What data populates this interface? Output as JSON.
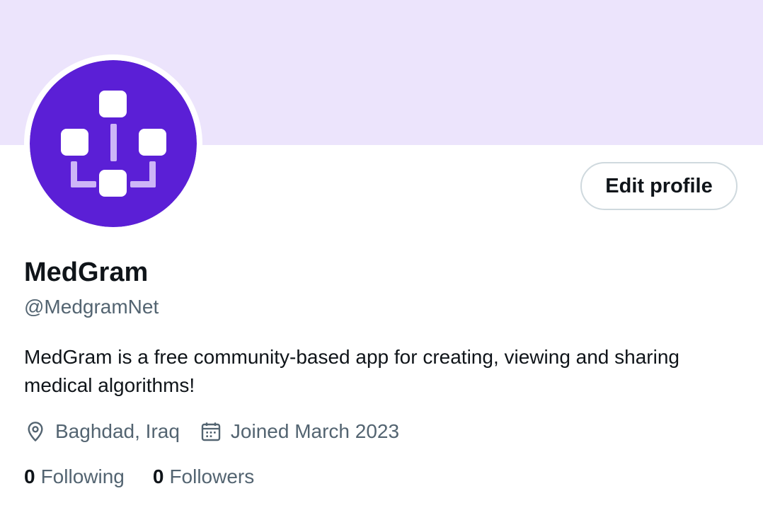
{
  "colors": {
    "banner": "#ece4fc",
    "avatar_bg": "#5b1fd6",
    "node": "#ffffff",
    "connector": "#cdb5f7",
    "text_primary": "#0f1419",
    "text_secondary": "#536471",
    "button_border": "#cfd9de"
  },
  "profile": {
    "display_name": "MedGram",
    "handle": "@MedgramNet",
    "bio": "MedGram is a free community-based app for creating, viewing and sharing medical algorithms!",
    "avatar_icon": "flowchart-logo-icon",
    "edit_button_label": "Edit profile",
    "location": {
      "icon": "location-pin-icon",
      "text": "Baghdad, Iraq"
    },
    "joined": {
      "icon": "calendar-icon",
      "text": "Joined March 2023"
    },
    "stats": {
      "following": {
        "count": "0",
        "label": "Following"
      },
      "followers": {
        "count": "0",
        "label": "Followers"
      }
    }
  }
}
